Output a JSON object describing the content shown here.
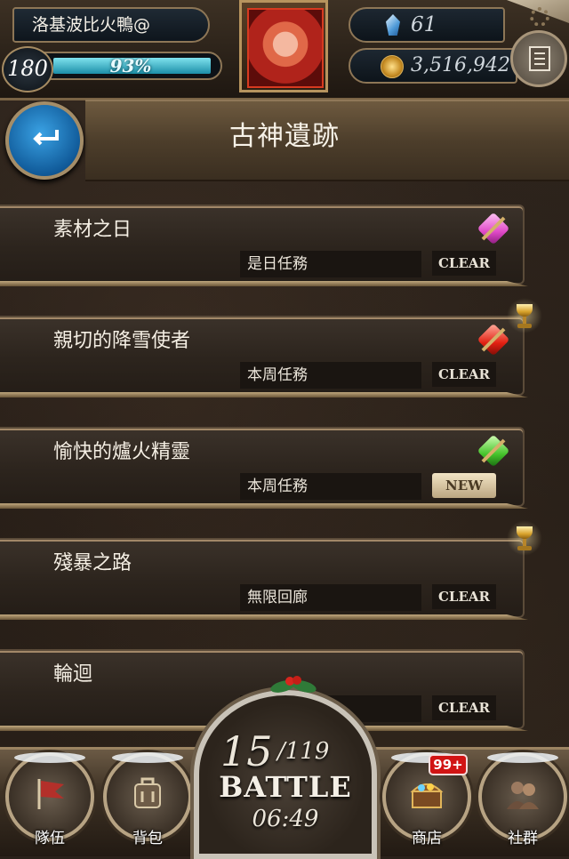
{
  "player": {
    "name": "洛基波比火鴨@",
    "level": "180",
    "exp_percent_text": "93%",
    "exp_fraction": 0.93,
    "gems": "61",
    "gold": "3,516,942"
  },
  "page": {
    "title": "古神遺跡"
  },
  "quests": [
    {
      "title": "素材之日",
      "type": "是日任務",
      "status": "CLEAR",
      "gem": "pink",
      "trophy": false
    },
    {
      "title": "親切的降雪使者",
      "type": "本周任務",
      "status": "CLEAR",
      "gem": "red",
      "trophy": true
    },
    {
      "title": "愉快的爐火精靈",
      "type": "本周任務",
      "status": "NEW",
      "gem": "green",
      "trophy": false
    },
    {
      "title": "殘暴之路",
      "type": "無限回廊",
      "status": "CLEAR",
      "gem": null,
      "trophy": true
    },
    {
      "title": "輪迴",
      "type": "",
      "status": "CLEAR",
      "gem": null,
      "trophy": false
    }
  ],
  "battle": {
    "stamina": "15",
    "stamina_max": "/119",
    "label": "BATTLE",
    "timer": "06:49"
  },
  "nav": {
    "team": "隊伍",
    "bag": "背包",
    "shop": "商店",
    "shop_badge": "99+",
    "social": "社群"
  },
  "colors": {
    "accent_blue": "#105a99",
    "exp_bar": "#1c8fa8",
    "badge_red": "#d11414",
    "trophy_gold": "#d9a32c"
  }
}
